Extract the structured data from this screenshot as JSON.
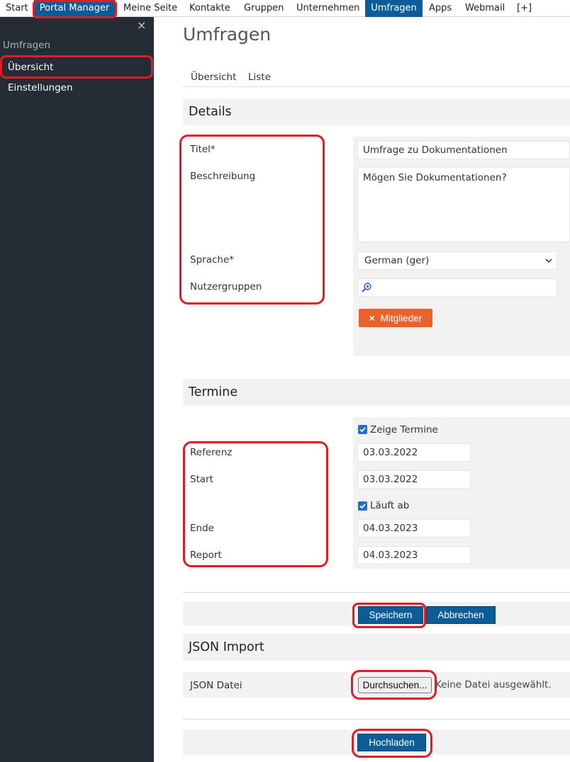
{
  "topnav": {
    "items": [
      {
        "label": "Start",
        "active": false
      },
      {
        "label": "Portal Manager",
        "active": true
      },
      {
        "label": "Meine Seite",
        "active": false
      },
      {
        "label": "Kontakte",
        "active": false
      },
      {
        "label": "Gruppen",
        "active": false
      },
      {
        "label": "Unternehmen",
        "active": false
      },
      {
        "label": "Umfragen",
        "active": true
      },
      {
        "label": "Apps",
        "active": false
      },
      {
        "label": "Webmail",
        "active": false
      },
      {
        "label": "[+]",
        "active": false
      }
    ]
  },
  "sidebar": {
    "close_icon": "×",
    "heading": "Umfragen",
    "items": [
      {
        "label": "Übersicht"
      },
      {
        "label": "Einstellungen"
      }
    ]
  },
  "main": {
    "title": "Umfragen",
    "tabs": [
      {
        "label": "Übersicht"
      },
      {
        "label": "Liste"
      }
    ]
  },
  "details": {
    "header": "Details",
    "labels": {
      "title": "Titel*",
      "description": "Beschreibung",
      "language": "Sprache*",
      "usergroups": "Nutzergruppen"
    },
    "values": {
      "title": "Umfrage zu Dokumentationen",
      "description": "Mögen Sie Dokumentationen?",
      "language": "German (ger)",
      "usergroups": ""
    },
    "members_button": "Mitglieder",
    "members_icon": "×"
  },
  "termine": {
    "header": "Termine",
    "show_dates_label": "Zeige Termine",
    "show_dates_checked": true,
    "expires_label": "Läuft ab",
    "expires_checked": true,
    "labels": {
      "reference": "Referenz",
      "start": "Start",
      "end": "Ende",
      "report": "Report"
    },
    "values": {
      "reference": "03.03.2022",
      "start": "03.03.2022",
      "end": "04.03.2023",
      "report": "04.03.2023"
    }
  },
  "actions": {
    "save": "Speichern",
    "cancel": "Abbrechen"
  },
  "json_import": {
    "header": "JSON Import",
    "file_label": "JSON Datei",
    "browse_button": "Durchsuchen...",
    "file_status": "Keine Datei ausgewählt.",
    "upload_button": "Hochladen"
  },
  "colors": {
    "nav_active": "#0c5d97",
    "sidebar_bg": "#262c35",
    "accent_orange": "#e8622a",
    "button_blue": "#0c5d97",
    "annotation_red": "#e31b23"
  }
}
